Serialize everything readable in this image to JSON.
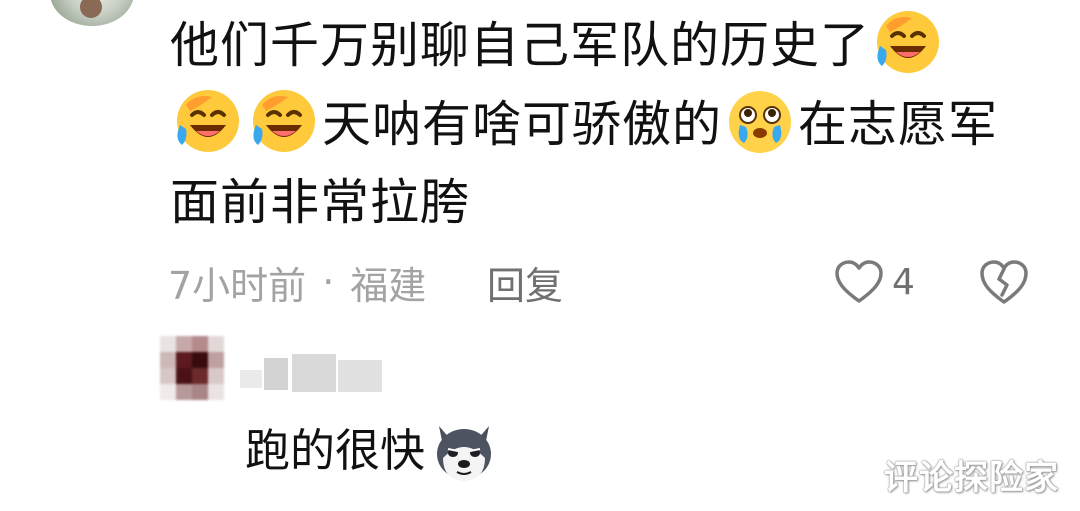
{
  "comment": {
    "line1": "他们千万别聊自己军队的历史了",
    "line2_text": "天呐有啥可骄傲的",
    "line2_tail": "在志愿军",
    "line3": "面前非常拉胯",
    "emoji_1": "laughing-crying-emoji",
    "emoji_2": "laughing-crying-emoji",
    "emoji_3": "laughing-crying-emoji",
    "emoji_4": "teary-eyed-emoji"
  },
  "meta": {
    "time": "7小时前",
    "separator": "·",
    "location": "福建",
    "reply_label": "回复",
    "like_count": "4",
    "like_icon": "heart-outline-icon",
    "dislike_icon": "broken-heart-icon"
  },
  "reply": {
    "text": "跑的很快",
    "emoji": "husky-dog-emoji"
  },
  "watermark": {
    "text": "评论探险家"
  },
  "colors": {
    "text_primary": "#111111",
    "text_meta": "#a3a3a3",
    "text_secondary": "#707070",
    "emoji_yellow": "#ffc93c",
    "emoji_tear": "#39a8ef"
  }
}
